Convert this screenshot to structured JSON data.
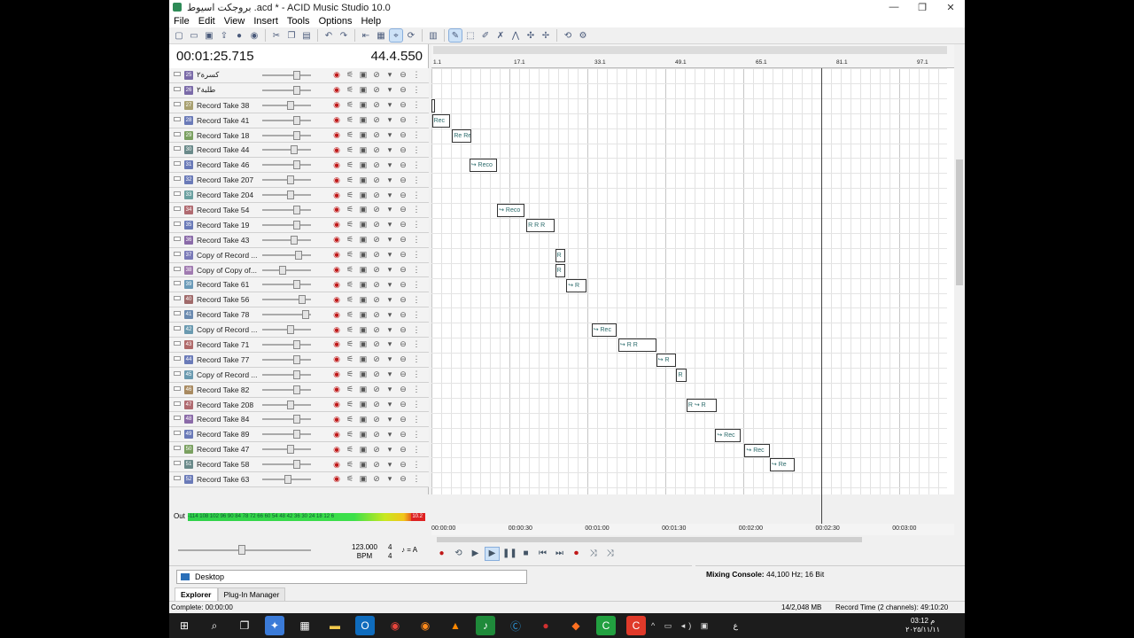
{
  "window": {
    "title": "بروجكت اسيوط .acd * - ACID Music Studio 10.0",
    "controls": [
      "—",
      "❐",
      "✕"
    ]
  },
  "menu": [
    "File",
    "Edit",
    "View",
    "Insert",
    "Tools",
    "Options",
    "Help"
  ],
  "time": {
    "position": "00:01:25.715",
    "beat": "44.4.550"
  },
  "tracks": [
    {
      "num": "25",
      "name": "كسرة٢",
      "color": "#7a6aa8",
      "vol": 0.78
    },
    {
      "num": "26",
      "name": "طلبة٢",
      "color": "#7a6aa8",
      "vol": 0.78
    },
    {
      "num": "27",
      "name": "Record Take 38",
      "color": "#a8a070",
      "vol": 0.62
    },
    {
      "num": "28",
      "name": "Record Take 41",
      "color": "#6a7ab8",
      "vol": 0.78
    },
    {
      "num": "29",
      "name": "Record Take 18",
      "color": "#7aa060",
      "vol": 0.78
    },
    {
      "num": "30",
      "name": "Record Take 44",
      "color": "#6a8a8a",
      "vol": 0.7
    },
    {
      "num": "31",
      "name": "Record Take 46",
      "color": "#6a7ab8",
      "vol": 0.78
    },
    {
      "num": "32",
      "name": "Record Take 207",
      "color": "#6a7ab8",
      "vol": 0.62
    },
    {
      "num": "33",
      "name": "Record Take 204",
      "color": "#6aa0a0",
      "vol": 0.62
    },
    {
      "num": "34",
      "name": "Record Take 54",
      "color": "#b06a70",
      "vol": 0.78
    },
    {
      "num": "35",
      "name": "Record Take 19",
      "color": "#6a7ab8",
      "vol": 0.78
    },
    {
      "num": "36",
      "name": "Record Take 43",
      "color": "#8a6aa8",
      "vol": 0.7
    },
    {
      "num": "37",
      "name": "Copy of Record ...",
      "color": "#7a7ab8",
      "vol": 0.82
    },
    {
      "num": "38",
      "name": "Copy of Copy of...",
      "color": "#a07ab0",
      "vol": 0.42
    },
    {
      "num": "39",
      "name": "Record Take 61",
      "color": "#6a9ab8",
      "vol": 0.78
    },
    {
      "num": "40",
      "name": "Record Take 56",
      "color": "#a06a6a",
      "vol": 0.9
    },
    {
      "num": "41",
      "name": "Record Take 78",
      "color": "#6a8ab0",
      "vol": 1.0
    },
    {
      "num": "42",
      "name": "Copy of Record ...",
      "color": "#6a9ab0",
      "vol": 0.62
    },
    {
      "num": "43",
      "name": "Record Take 71",
      "color": "#b06a6a",
      "vol": 0.78
    },
    {
      "num": "44",
      "name": "Record Take 77",
      "color": "#6a7ab8",
      "vol": 0.78
    },
    {
      "num": "45",
      "name": "Copy of Record ...",
      "color": "#6a9ab0",
      "vol": 0.78
    },
    {
      "num": "46",
      "name": "Record Take 82",
      "color": "#a88a60",
      "vol": 0.78
    },
    {
      "num": "47",
      "name": "Record Take 208",
      "color": "#b06a70",
      "vol": 0.62
    },
    {
      "num": "48",
      "name": "Record Take 84",
      "color": "#8a6aa8",
      "vol": 0.78
    },
    {
      "num": "49",
      "name": "Record Take 89",
      "color": "#6a7ab8",
      "vol": 0.78
    },
    {
      "num": "50",
      "name": "Record Take 47",
      "color": "#7aa060",
      "vol": 0.62
    },
    {
      "num": "51",
      "name": "Record Take 58",
      "color": "#6a8a8a",
      "vol": 0.78
    },
    {
      "num": "52",
      "name": "Record Take 63",
      "color": "#6a7ab8",
      "vol": 0.55
    }
  ],
  "ruler": {
    "bars": [
      "1.1",
      "17.1",
      "33.1",
      "49.1",
      "65.1",
      "81.1",
      "97.1"
    ],
    "times": [
      "00:00:00",
      "00:00:30",
      "00:01:00",
      "00:01:30",
      "00:02:00",
      "00:02:30",
      "00:03:00"
    ]
  },
  "clips": [
    {
      "row": 2,
      "start": 0.0,
      "len": 0.5,
      "label": ""
    },
    {
      "row": 3,
      "start": 0.1,
      "len": 3.5,
      "label": "Rec"
    },
    {
      "row": 4,
      "start": 4.1,
      "len": 3.8,
      "label": "Re Re"
    },
    {
      "row": 6,
      "start": 7.5,
      "len": 5.5,
      "label": "↪ Reco"
    },
    {
      "row": 9,
      "start": 13.0,
      "len": 5.5,
      "label": "↪ Reco"
    },
    {
      "row": 10,
      "start": 18.8,
      "len": 5.5,
      "label": "R R R"
    },
    {
      "row": 12,
      "start": 24.5,
      "len": 2.0,
      "label": "R"
    },
    {
      "row": 13,
      "start": 24.5,
      "len": 2.0,
      "label": "R"
    },
    {
      "row": 14,
      "start": 26.7,
      "len": 4.0,
      "label": "↪ R"
    },
    {
      "row": 17,
      "start": 31.7,
      "len": 5.0,
      "label": "↪ Rec"
    },
    {
      "row": 18,
      "start": 37.0,
      "len": 7.5,
      "label": "↪ R R"
    },
    {
      "row": 19,
      "start": 44.5,
      "len": 4.0,
      "label": "↪ R"
    },
    {
      "row": 20,
      "start": 48.5,
      "len": 2.0,
      "label": "R"
    },
    {
      "row": 22,
      "start": 50.5,
      "len": 6.0,
      "label": "R ↪ R"
    },
    {
      "row": 24,
      "start": 56.2,
      "len": 5.0,
      "label": "↪ Rec"
    },
    {
      "row": 25,
      "start": 62.0,
      "len": 5.0,
      "label": "↪ Rec"
    },
    {
      "row": 26,
      "start": 67.0,
      "len": 5.0,
      "label": "↪ Re"
    }
  ],
  "transport_buttons": [
    "●",
    "⟲",
    "▶",
    "▶",
    "❚❚",
    "■",
    "⏮",
    "⏭",
    "⏺",
    "⤨",
    "⤨"
  ],
  "tempo": {
    "bpm_value": "123.000",
    "bpm_label": "BPM",
    "sig_top": "4",
    "sig_bottom": "4",
    "key": "A"
  },
  "vu": {
    "out_label": "Out",
    "scale": "-114 108 102 96 90 84 78 72 66 60 54 48 42 36 30 24 18 12 6",
    "peak": "10.2"
  },
  "explorer": {
    "path": "Desktop",
    "tabs": [
      "Explorer",
      "Plug-In Manager"
    ]
  },
  "mixer": {
    "label": "Mixing Console:",
    "format": "44,100 Hz; 16 Bit"
  },
  "status": {
    "left": "Complete: 00:00:00",
    "memory": "14/2,048 MB",
    "record_time": "Record Time (2 channels): 49:10:20"
  },
  "taskbar": {
    "time": "03:12 م",
    "date": "٢٠٢٥/١١/١١",
    "lang": "ع"
  }
}
